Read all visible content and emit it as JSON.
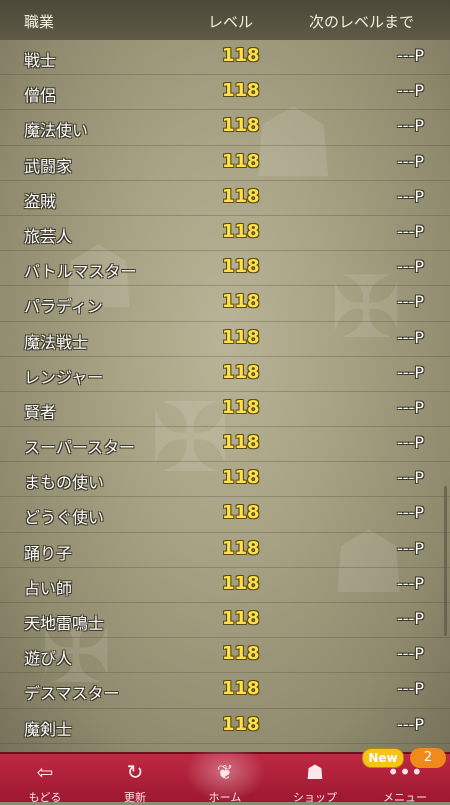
{
  "header": {
    "job_label": "職業",
    "level_label": "レベル",
    "next_label": "次のレベルまで"
  },
  "rows": [
    {
      "job": "戦士",
      "level": "118",
      "next": "---P"
    },
    {
      "job": "僧侶",
      "level": "118",
      "next": "---P"
    },
    {
      "job": "魔法使い",
      "level": "118",
      "next": "---P"
    },
    {
      "job": "武闘家",
      "level": "118",
      "next": "---P"
    },
    {
      "job": "盗賊",
      "level": "118",
      "next": "---P"
    },
    {
      "job": "旅芸人",
      "level": "118",
      "next": "---P"
    },
    {
      "job": "バトルマスター",
      "level": "118",
      "next": "---P"
    },
    {
      "job": "パラディン",
      "level": "118",
      "next": "---P"
    },
    {
      "job": "魔法戦士",
      "level": "118",
      "next": "---P"
    },
    {
      "job": "レンジャー",
      "level": "118",
      "next": "---P"
    },
    {
      "job": "賢者",
      "level": "118",
      "next": "---P"
    },
    {
      "job": "スーパースター",
      "level": "118",
      "next": "---P"
    },
    {
      "job": "まもの使い",
      "level": "118",
      "next": "---P"
    },
    {
      "job": "どうぐ使い",
      "level": "118",
      "next": "---P"
    },
    {
      "job": "踊り子",
      "level": "118",
      "next": "---P"
    },
    {
      "job": "占い師",
      "level": "118",
      "next": "---P"
    },
    {
      "job": "天地雷鳴士",
      "level": "118",
      "next": "---P"
    },
    {
      "job": "遊び人",
      "level": "118",
      "next": "---P"
    },
    {
      "job": "デスマスター",
      "level": "118",
      "next": "---P"
    },
    {
      "job": "魔剣士",
      "level": "118",
      "next": "---P"
    }
  ],
  "nav": {
    "back": {
      "label": "もどる",
      "icon": "back-arrow-icon"
    },
    "update": {
      "label": "更新",
      "icon": "refresh-icon"
    },
    "home": {
      "label": "ホーム",
      "icon": "home-dracky-icon"
    },
    "shop": {
      "label": "ショップ",
      "icon": "slime-icon"
    },
    "menu": {
      "label": "メニュー",
      "icon": "more-dots-icon",
      "new_badge": "New",
      "count_badge": "2"
    }
  },
  "colors": {
    "nav_bg": "#b0203a",
    "level_text": "#ffe14a",
    "header_bg": "#55513f"
  }
}
